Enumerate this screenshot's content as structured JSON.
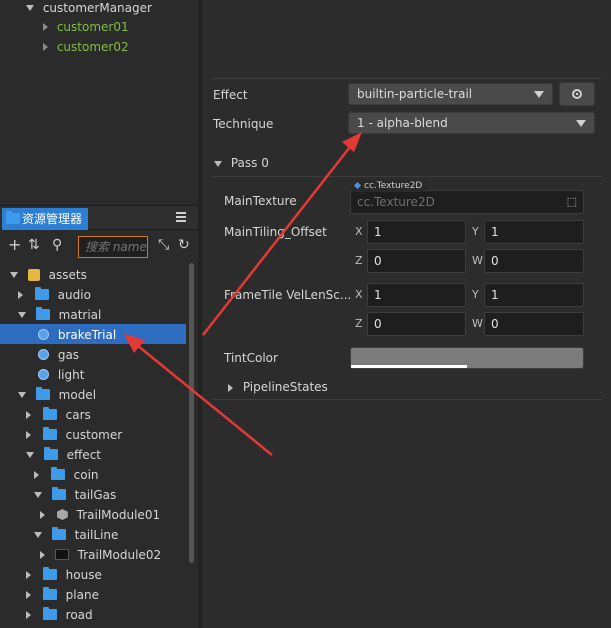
{
  "hierarchy": {
    "items": [
      {
        "label": "customerManager"
      },
      {
        "label": "customer01"
      },
      {
        "label": "customer02"
      }
    ]
  },
  "assets_panel": {
    "tab_label": "资源管理器",
    "search_placeholder": "搜索 name",
    "tree": [
      {
        "label": "assets"
      },
      {
        "label": "audio"
      },
      {
        "label": "matrial"
      },
      {
        "label": "brakeTrial"
      },
      {
        "label": "gas"
      },
      {
        "label": "light"
      },
      {
        "label": "model"
      },
      {
        "label": "cars"
      },
      {
        "label": "customer"
      },
      {
        "label": "effect"
      },
      {
        "label": "coin"
      },
      {
        "label": "tailGas"
      },
      {
        "label": "TrailModule01"
      },
      {
        "label": "tailLine"
      },
      {
        "label": "TrailModule02"
      },
      {
        "label": "house"
      },
      {
        "label": "plane"
      },
      {
        "label": "road"
      }
    ]
  },
  "inspector": {
    "effect_label": "Effect",
    "effect_value": "builtin-particle-trail",
    "technique_label": "Technique",
    "technique_value": "1 - alpha-blend",
    "pass_label": "Pass 0",
    "main_texture_label": "MainTexture",
    "main_texture_badge": "cc.Texture2D",
    "main_texture_value": "cc.Texture2D",
    "main_tiling_label": "MainTiling_Offset",
    "main_tiling": {
      "x": "1",
      "y": "1",
      "z": "0",
      "w": "0"
    },
    "frametile_label": "FrameTile VelLenSc...",
    "frametile": {
      "x": "1",
      "y": "1",
      "z": "0",
      "w": "0"
    },
    "tint_label": "TintColor",
    "tint_color": "#7c7c7c",
    "pipeline_label": "PipelineStates",
    "axis": {
      "x": "X",
      "y": "Y",
      "z": "Z",
      "w": "W"
    }
  },
  "colors": {
    "selection": "#2d6cc0",
    "tab_active": "#2d7fd3",
    "folder": "#3d9be9",
    "green_text": "#7fbf3f",
    "annotation_arrow": "#e53935"
  }
}
